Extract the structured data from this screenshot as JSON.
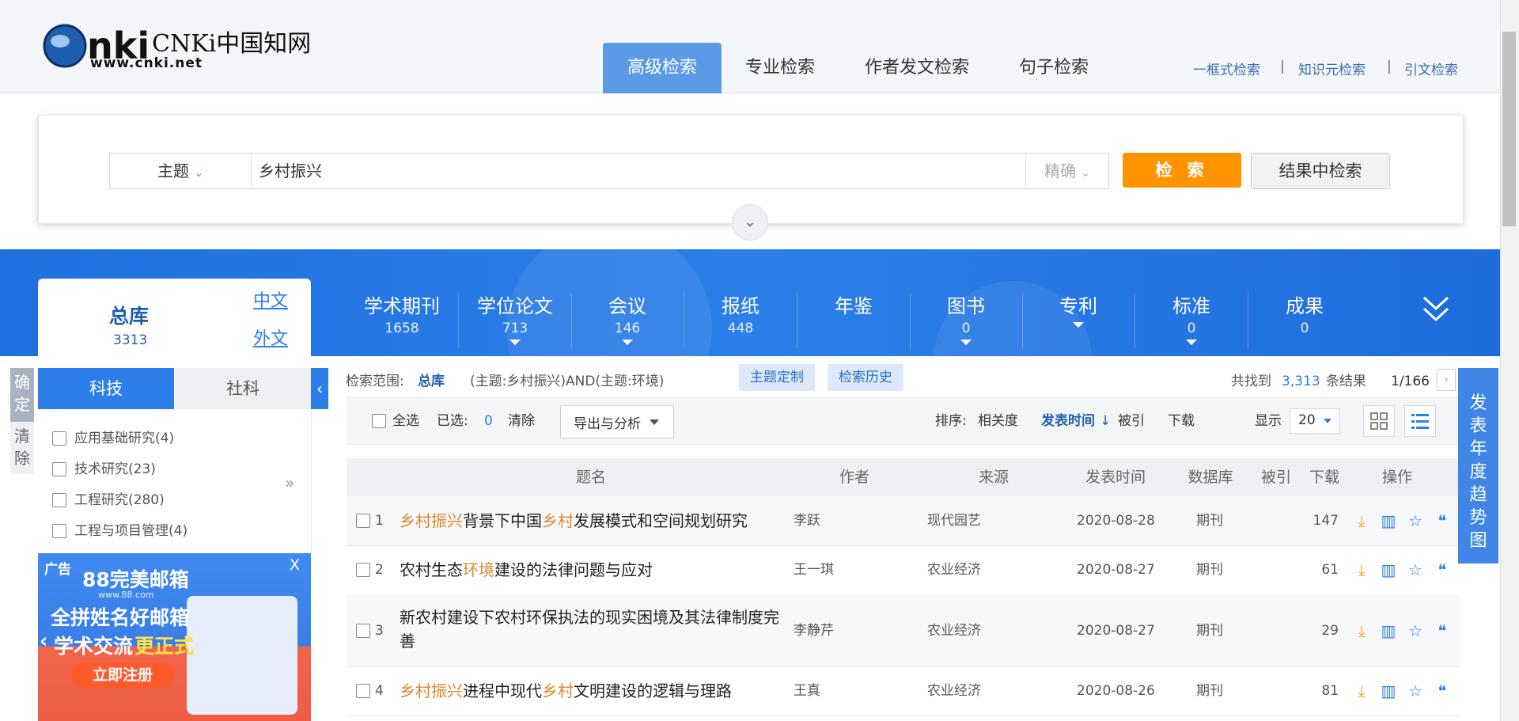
{
  "header": {
    "logo_text": "CNKi中国知网",
    "logo_url_text": "www.cnki.net",
    "nav_tabs": [
      "高级检索",
      "专业检索",
      "作者发文检索",
      "句子检索"
    ],
    "active_tab": "高级检索",
    "top_links": [
      "一框式检索",
      "知识元检索",
      "引文检索"
    ],
    "separator": "|"
  },
  "search": {
    "field": "主题",
    "query": "乡村振兴",
    "match": "精确",
    "search_button": "检 索",
    "within_button": "结果中检索"
  },
  "databases": {
    "total": {
      "name": "总库",
      "count": "3313"
    },
    "lang_links": [
      "中文",
      "外文"
    ],
    "items": [
      {
        "name": "学术期刊",
        "count": "1658",
        "caret": false
      },
      {
        "name": "学位论文",
        "count": "713",
        "caret": true
      },
      {
        "name": "会议",
        "count": "146",
        "caret": true
      },
      {
        "name": "报纸",
        "count": "448",
        "caret": false
      },
      {
        "name": "年鉴",
        "count": "",
        "caret": false
      },
      {
        "name": "图书",
        "count": "0",
        "caret": true
      },
      {
        "name": "专利",
        "count": "",
        "caret": true
      },
      {
        "name": "标准",
        "count": "0",
        "caret": true
      },
      {
        "name": "成果",
        "count": "0",
        "caret": false
      }
    ]
  },
  "sidebar": {
    "confirm": "确定",
    "clear": "清除",
    "tabs": [
      "科技",
      "社科"
    ],
    "active_tab": "科技",
    "categories": [
      "应用基础研究(4)",
      "技术研究(23)",
      "工程研究(280)",
      "工程与项目管理(4)"
    ],
    "ad_label": "广告",
    "ad_brand": "88完美邮箱",
    "ad_brand_url": "www.88.com",
    "ad_line1": "全拼姓名好邮箱",
    "ad_line2_a": "学术交流",
    "ad_line2_b": "更正式",
    "ad_cta": "立即注册",
    "ad_close": "X"
  },
  "results": {
    "scope_label": "检索范围:",
    "scope_value": "总库",
    "query_expr": "(主题:乡村振兴)AND(主题:环境)",
    "chips": [
      "主题定制",
      "检索历史"
    ],
    "found_prefix": "共找到",
    "found_count": "3,313",
    "found_suffix": "条结果",
    "page_info": "1/166",
    "select_all": "全选",
    "selected_label": "已选:",
    "selected_count": "0",
    "clear": "清除",
    "export": "导出与分析",
    "sort_label": "排序:",
    "sort_options": [
      "相关度",
      "发表时间",
      "被引",
      "下载"
    ],
    "active_sort": "发表时间",
    "display_label": "显示",
    "page_size": "20",
    "columns": [
      "题名",
      "作者",
      "来源",
      "发表时间",
      "数据库",
      "被引",
      "下载",
      "操作"
    ],
    "rows": [
      {
        "n": "1",
        "title_parts": [
          {
            "t": "乡村振兴",
            "hl": true
          },
          {
            "t": "背景下中国",
            "hl": false
          },
          {
            "t": "乡村",
            "hl": true
          },
          {
            "t": "发展模式和空间规划研究",
            "hl": false
          }
        ],
        "author": "李跃",
        "source": "现代园艺",
        "date": "2020-08-28",
        "db": "期刊",
        "cited": "",
        "downloads": "147"
      },
      {
        "n": "2",
        "title_parts": [
          {
            "t": "农村生态",
            "hl": false
          },
          {
            "t": "环境",
            "hl": true
          },
          {
            "t": "建设的法律问题与应对",
            "hl": false
          }
        ],
        "author": "王一琪",
        "source": "农业经济",
        "date": "2020-08-27",
        "db": "期刊",
        "cited": "",
        "downloads": "61"
      },
      {
        "n": "3",
        "title_parts": [
          {
            "t": "新农村建设下农村环保执法的现实困境及其法律制度完善",
            "hl": false
          }
        ],
        "author": "李静芹",
        "source": "农业经济",
        "date": "2020-08-27",
        "db": "期刊",
        "cited": "",
        "downloads": "29"
      },
      {
        "n": "4",
        "title_parts": [
          {
            "t": "乡村振兴",
            "hl": true
          },
          {
            "t": "进程中现代",
            "hl": false
          },
          {
            "t": "乡村",
            "hl": true
          },
          {
            "t": "文明建设的逻辑与理路",
            "hl": false
          }
        ],
        "author": "王真",
        "source": "农业经济",
        "date": "2020-08-26",
        "db": "期刊",
        "cited": "",
        "downloads": "81"
      }
    ]
  },
  "trend_tab": "发表年度趋势图",
  "colors": {
    "brand_blue": "#2c7fe8",
    "search_orange": "#ff9300",
    "highlight": "#e0862c"
  }
}
